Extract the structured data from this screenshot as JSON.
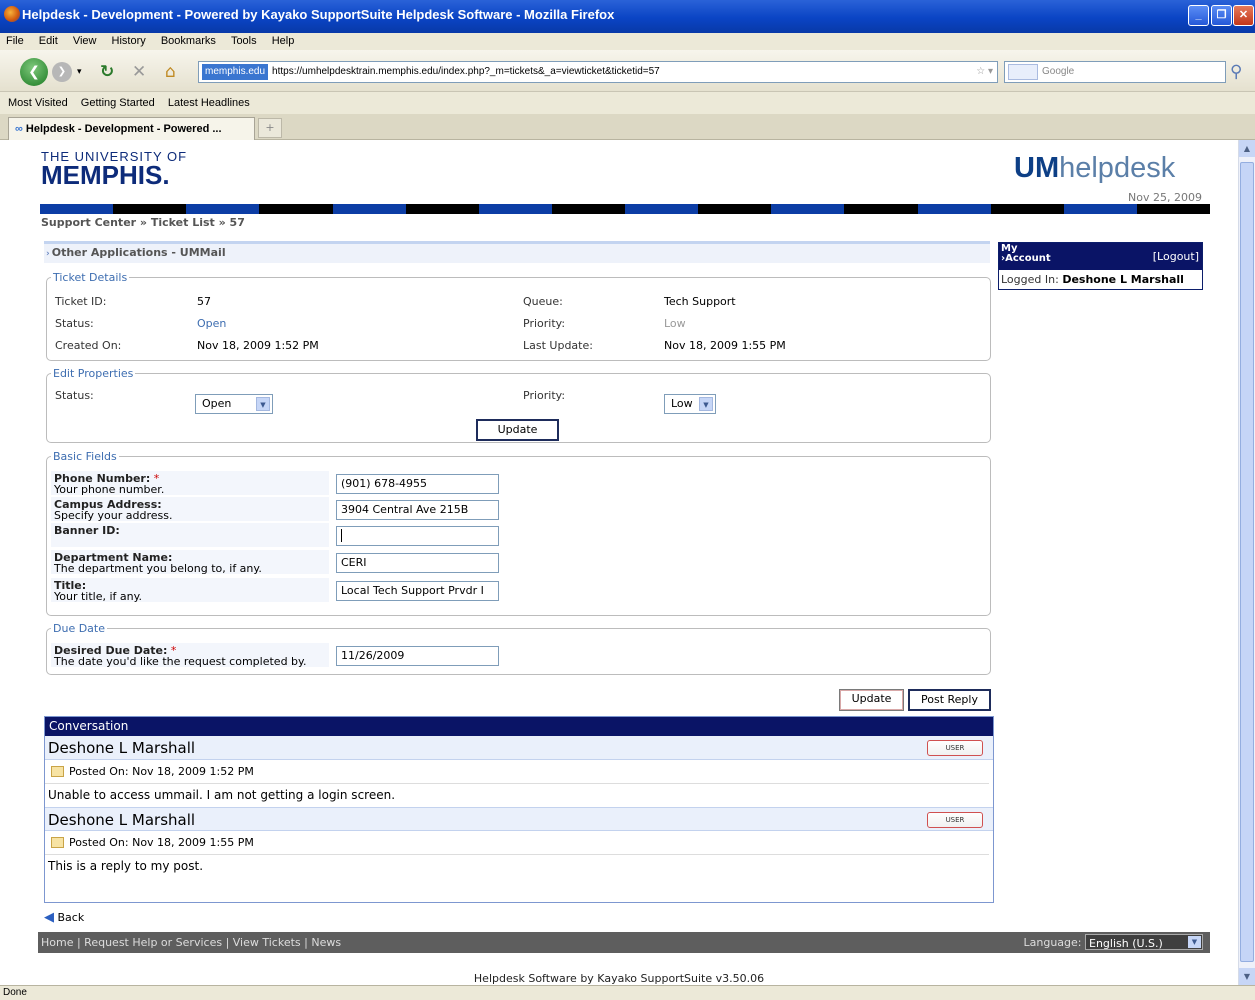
{
  "window": {
    "title": "Helpdesk - Development - Powered by Kayako SupportSuite Helpdesk Software - Mozilla Firefox"
  },
  "menu": [
    "File",
    "Edit",
    "View",
    "History",
    "Bookmarks",
    "Tools",
    "Help"
  ],
  "nav": {
    "site_badge": "memphis.edu",
    "url": "https://umhelpdesktrain.memphis.edu/index.php?_m=tickets&_a=viewticket&ticketid=57",
    "search_placeholder": "Google"
  },
  "bookmarks": [
    "Most Visited",
    "Getting Started",
    "Latest Headlines"
  ],
  "tab": {
    "label": "Helpdesk - Development - Powered ..."
  },
  "header": {
    "logo_top": "THE UNIVERSITY OF",
    "logo_main": "MEMPHIS.",
    "brand_bold": "UM",
    "brand_rest": "helpdesk",
    "date": "Nov 25, 2009",
    "breadcrumb": "Support Center » Ticket List » 57"
  },
  "category": "Other Applications - UMMail",
  "ticket_details": {
    "legend": "Ticket Details",
    "ticket_id_label": "Ticket ID:",
    "ticket_id": "57",
    "queue_label": "Queue:",
    "queue": "Tech Support",
    "status_label": "Status:",
    "status": "Open",
    "priority_label": "Priority:",
    "priority": "Low",
    "created_label": "Created On:",
    "created": "Nov 18, 2009 1:52 PM",
    "updated_label": "Last Update:",
    "updated": "Nov 18, 2009 1:55 PM"
  },
  "edit_properties": {
    "legend": "Edit Properties",
    "status_label": "Status:",
    "status_value": "Open",
    "priority_label": "Priority:",
    "priority_value": "Low",
    "update_label": "Update"
  },
  "basic_fields": {
    "legend": "Basic Fields",
    "phone_label": "Phone Number:",
    "phone_desc": "Your phone number.",
    "phone_value": "(901) 678-4955",
    "campus_label": "Campus Address:",
    "campus_desc": "Specify your address.",
    "campus_value": "3904 Central Ave 215B",
    "banner_label": "Banner ID:",
    "banner_value": "",
    "dept_label": "Department Name:",
    "dept_desc": "The department you belong to, if any.",
    "dept_value": "CERI",
    "title_label": "Title:",
    "title_desc": "Your title, if any.",
    "title_value": "Local Tech Support Prvdr I",
    "required_mark": "*"
  },
  "due_date": {
    "legend": "Due Date",
    "label": "Desired Due Date:",
    "desc": "The date you'd like the request completed by.",
    "value": "11/26/2009"
  },
  "actions": {
    "update": "Update",
    "post_reply": "Post Reply"
  },
  "account": {
    "title_line1": "My",
    "title_line2": "Account",
    "logout": "[Logout]",
    "logged_in_label": "Logged In:",
    "user": "Deshone L Marshall"
  },
  "conversation": {
    "title": "Conversation",
    "user_badge": "USER",
    "posts": [
      {
        "author": "Deshone L Marshall",
        "posted": "Posted On: Nov 18, 2009 1:52 PM",
        "message": "Unable to access ummail. I am not getting a login screen."
      },
      {
        "author": "Deshone L Marshall",
        "posted": "Posted On: Nov 18, 2009 1:55 PM",
        "message": "This is a reply to my post."
      }
    ]
  },
  "back": "Back",
  "footer": {
    "links": "Home | Request Help or Services | View Tickets | News",
    "language_label": "Language:",
    "language_value": "English (U.S.)",
    "powered": "Helpdesk Software by Kayako SupportSuite v3.50.06"
  },
  "status_text": "Done"
}
